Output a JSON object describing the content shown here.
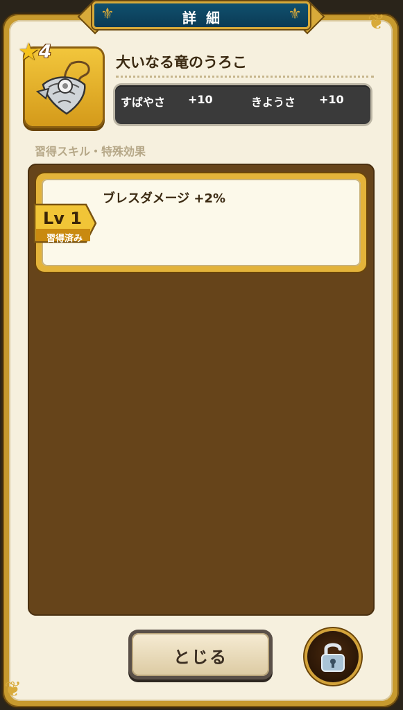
{
  "header": {
    "title": "詳細"
  },
  "item": {
    "icon": "dragon-scale-icon",
    "rarity": "4",
    "name": "大いなる竜のうろこ",
    "stats": [
      {
        "label": "すばやさ",
        "value": "+10"
      },
      {
        "label": "きようさ",
        "value": "+10"
      }
    ]
  },
  "skills": {
    "section_label": "習得スキル・特殊効果",
    "items": [
      {
        "level": "Lv 1",
        "status": "習得済み",
        "effect": "ブレスダメージ +2%"
      }
    ]
  },
  "footer": {
    "close_label": "とじる",
    "lock_icon": "unlock-icon"
  },
  "colors": {
    "panel_bg": "#f6f0de",
    "gold_border": "#c79a2e",
    "title_bar": "#0b3b55",
    "list_bg": "#66441a",
    "stats_bg": "#3a3a3a"
  }
}
